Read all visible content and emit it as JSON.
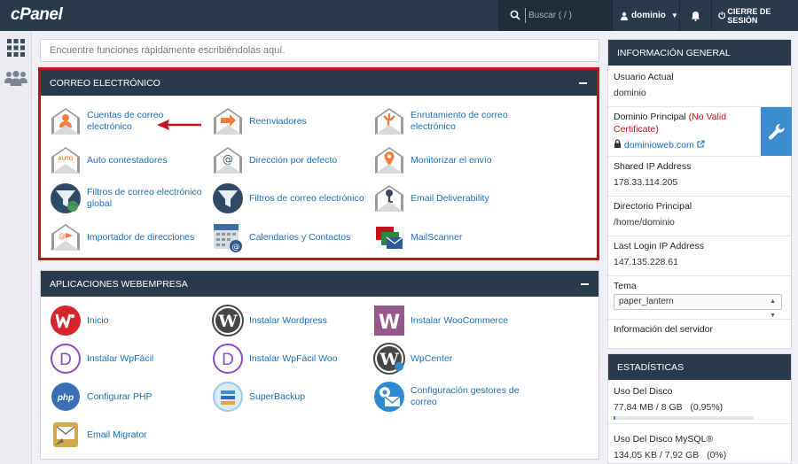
{
  "topbar": {
    "logo": "cPanel",
    "search_placeholder": "Buscar ( / )",
    "user": "dominio",
    "logout": "CIERRE DE SESIÓN"
  },
  "function_search": {
    "placeholder": "Encuentre funciones rápidamente escribiéndolas aquí."
  },
  "email_panel": {
    "title": "CORREO ELECTRÓNICO",
    "items": [
      {
        "label": "Cuentas de correo electrónico",
        "icon": "envelope-user-icon"
      },
      {
        "label": "Reenviadores",
        "icon": "envelope-forward-icon"
      },
      {
        "label": "Enrutamiento de correo electrónico",
        "icon": "envelope-route-icon"
      },
      {
        "label": "Auto contestadores",
        "icon": "envelope-auto-icon"
      },
      {
        "label": "Dirección por defecto",
        "icon": "envelope-at-icon"
      },
      {
        "label": "Monitorizar el envío",
        "icon": "envelope-pin-icon"
      },
      {
        "label": "Filtros de correo electrónico global",
        "icon": "filter-globe-icon"
      },
      {
        "label": "Filtros de correo electrónico",
        "icon": "filter-icon"
      },
      {
        "label": "Email Deliverability",
        "icon": "envelope-key-icon"
      },
      {
        "label": "Importador de direcciones",
        "icon": "envelope-import-icon"
      },
      {
        "label": "Calendarios y Contactos",
        "icon": "calendar-icon"
      },
      {
        "label": "MailScanner",
        "icon": "mailscanner-icon"
      }
    ]
  },
  "apps_panel": {
    "title": "APLICACIONES WEBEMPRESA",
    "items": [
      {
        "label": "Inicio",
        "icon": "webempresa-icon"
      },
      {
        "label": "Instalar Wordpress",
        "icon": "wordpress-icon"
      },
      {
        "label": "Instalar WooCommerce",
        "icon": "woocommerce-icon"
      },
      {
        "label": "Instalar WpFácil",
        "icon": "wpfacil-icon"
      },
      {
        "label": "Instalar WpFácil Woo",
        "icon": "wpfacil-woo-icon"
      },
      {
        "label": "WpCenter",
        "icon": "wpcenter-icon"
      },
      {
        "label": "Configurar PHP",
        "icon": "php-icon"
      },
      {
        "label": "SuperBackup",
        "icon": "superbackup-icon"
      },
      {
        "label": "Configuración gestores de correo",
        "icon": "mail-config-icon"
      },
      {
        "label": "Email Migrator",
        "icon": "email-migrator-icon"
      }
    ]
  },
  "general_info": {
    "title": "INFORMACIÓN GENERAL",
    "current_user_label": "Usuario Actual",
    "current_user": "dominio",
    "main_domain_label": "Dominio Principal",
    "cert_warning": "(No Valid Certificate)",
    "main_domain": "dominioweb.com",
    "shared_ip_label": "Shared IP Address",
    "shared_ip": "178.33.114.205",
    "home_dir_label": "Directorio Principal",
    "home_dir": "/home/dominio",
    "last_login_label": "Last Login IP Address",
    "last_login": "147.135.228.61",
    "theme_label": "Tema",
    "theme": "paper_lantern",
    "server_info": "Información del servidor"
  },
  "stats": {
    "title": "ESTADÍSTICAS",
    "disk_label": "Uso Del Disco",
    "disk_value": "77,84 MB / 8 GB",
    "disk_pct": "(0,95%)",
    "disk_fraction": 0.0095,
    "mysql_label": "Uso Del Disco MySQL®",
    "mysql_value": "134,05 KB / 7,92 GB",
    "mysql_pct": "(0%)"
  },
  "colors": {
    "header": "#293a4a",
    "link": "#1b6fb8",
    "highlight": "#c4121b",
    "accent": "#3a8dd0"
  }
}
